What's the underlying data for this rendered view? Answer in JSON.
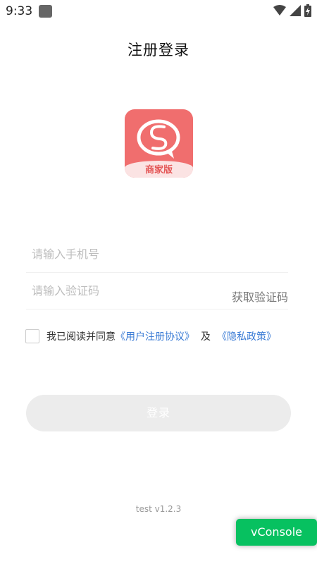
{
  "status_bar": {
    "time": "9:33",
    "icons": [
      "app-notification-icon",
      "wifi-icon",
      "cellular-signal-icon",
      "battery-charging-icon"
    ]
  },
  "page": {
    "title": "注册登录"
  },
  "logo": {
    "caption": "商家版",
    "colors": {
      "background": "#f06e6e",
      "band": "#fbe3e3",
      "caption": "#e45757"
    }
  },
  "form": {
    "phone_placeholder": "请输入手机号",
    "code_placeholder": "请输入验证码",
    "get_code_label": "获取验证码"
  },
  "agreement": {
    "prefix": "我已阅读并同意",
    "user_agreement_link": "《用户注册协议》",
    "conjunction": "及",
    "privacy_link": "《隐私政策》",
    "checked": false,
    "link_color": "#3a7bd5"
  },
  "login_button": {
    "label": "登录",
    "enabled": false
  },
  "footer": {
    "version": "test v1.2.3"
  },
  "vconsole": {
    "label": "vConsole",
    "color": "#07c160"
  }
}
